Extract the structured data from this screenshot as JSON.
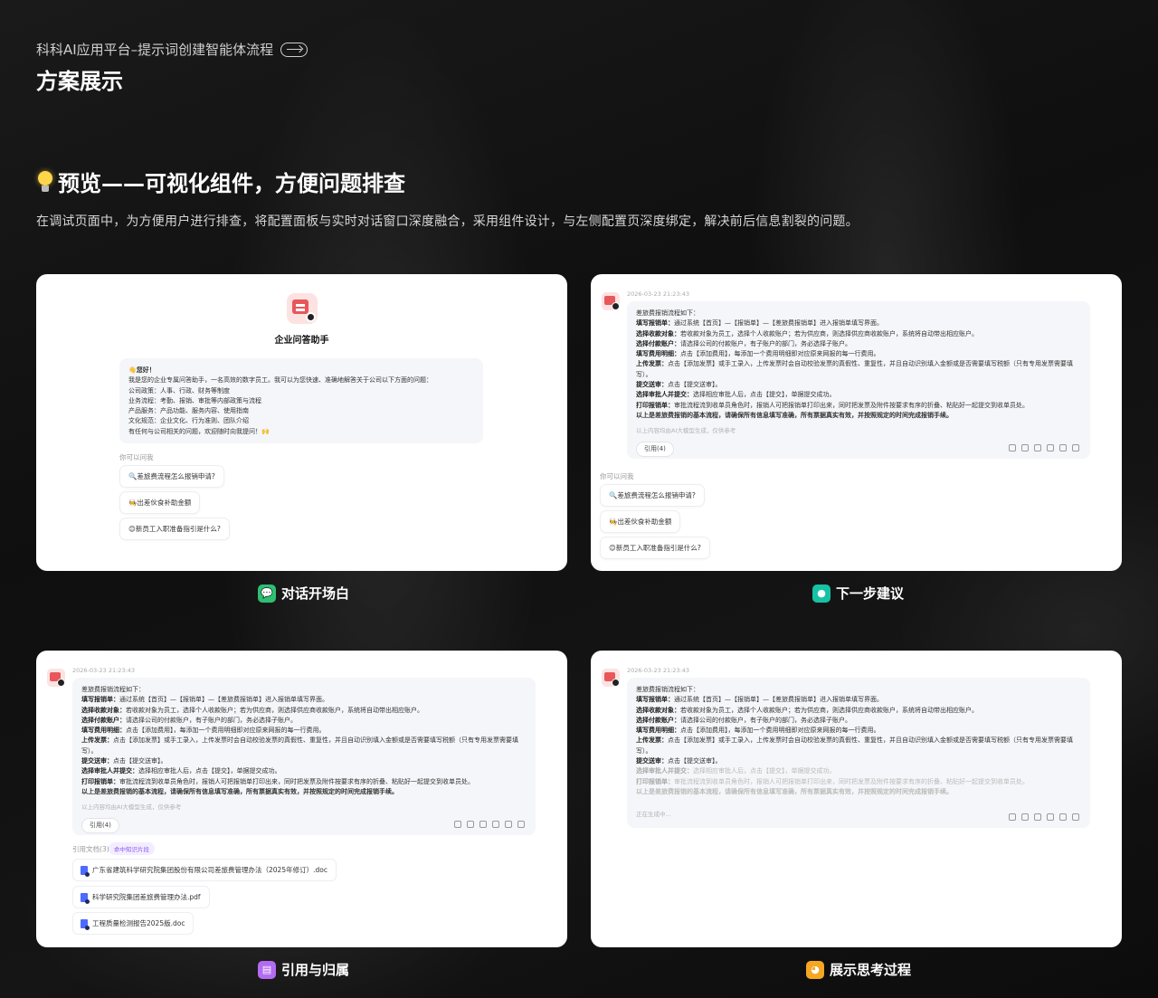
{
  "header": {
    "kicker": "科科AI应用平台–提示词创建智能体流程",
    "title": "方案展示"
  },
  "section": {
    "title": "预览——可视化组件，方便问题排查",
    "description": "在调试页面中，为方便用户进行排查，将配置面板与实时对话窗口深度融合，采用组件设计，与左侧配置页深度绑定，解决前后信息割裂的问题。"
  },
  "colors": {
    "cap1": "#2fbf71",
    "cap2": "#16c2a3",
    "cap3": "#b36bf2",
    "cap4": "#f5a623"
  },
  "card1": {
    "bot_name": "企业问答助手",
    "greeting_lines": [
      "👋您好！",
      "我是您的企业专属问答助手，一名高效的数字员工。我可以为您快速、准确地解答关于公司以下方面的问题：",
      "公司政策：人事、行政、财务等制度",
      "业务流程：考勤、报销、审批等内部政策与流程",
      "产品服务：产品功能、服务内容、使用指南",
      "文化规范：企业文化、行为准则、团队介绍",
      "有任何与公司相关的问题，欢迎随时向我提问！🙌"
    ],
    "suggest_label": "你可以问我",
    "suggestions": [
      "🔍差旅费流程怎么报销申请?",
      "🧑‍🍳出差伙食补助金额",
      "😊新员工入职准备指引是什么?"
    ],
    "caption": "对话开场白"
  },
  "answer": {
    "timestamp": "2026-03-23 21:23:43",
    "intro": "差旅费报销流程如下：",
    "steps": [
      {
        "k": "填写报销单：",
        "v": "通过系统【首页】—【报销单】—【差旅费报销单】进入报销单填写界面。"
      },
      {
        "k": "选择收款对象：",
        "v": "若收款对象为员工，选择个人收款账户；若为供应商，则选择供应商收款账户，系统将自动带出相应账户。"
      },
      {
        "k": "选择付款账户：",
        "v": "请选择公司的付款账户，有子账户的部门，务必选择子账户。"
      },
      {
        "k": "填写费用明细：",
        "v": "点击【添加费用】，每添加一个费用明细即对应原来网报的每一行费用。"
      },
      {
        "k": "上传发票：",
        "v": "点击【添加发票】或手工录入，上传发票时会自动校验发票的真假性、重复性，并且自动识别填入金额或是否需要填写税额（只有专用发票需要填写）。"
      },
      {
        "k": "提交送审：",
        "v": "点击【提交送审】。"
      },
      {
        "k": "选择审批人并提交：",
        "v": "选择相应审批人后，点击【提交】，单据提交成功。"
      },
      {
        "k": "打印报销单：",
        "v": "审批流程流到收单员角色时，报销人可把报销单打印出来，同时把发票及附件按要求有序的折叠、粘贴好一起提交到收单员处。"
      }
    ],
    "summary": "以上是差旅费报销的基本流程，请确保所有信息填写准确，所有票据真实有效，并按照规定的时间完成报销手续。",
    "disclaimer": "以上内容均由AI大模型生成，仅供参考",
    "cite_label": "引用(4)"
  },
  "card2": {
    "suggest_label": "你可以问我",
    "suggestions": [
      "🔍差旅费流程怎么报销申请?",
      "🧑‍🍳出差伙食补助金额",
      "😊新员工入职准备指引是什么?"
    ],
    "caption": "下一步建议"
  },
  "card3": {
    "docs_label": "引用文档(3)",
    "tag": "命中知识片段",
    "files": [
      "广东省建筑科学研究院集团股份有限公司差旅费管理办法（2025年修订）.doc",
      "科学研究院集团差旅费管理办法.pdf",
      "工程质量检测报告2025版.doc"
    ],
    "caption": "引用与归属"
  },
  "card4": {
    "generating": "正在生成中…",
    "caption": "展示思考过程"
  }
}
